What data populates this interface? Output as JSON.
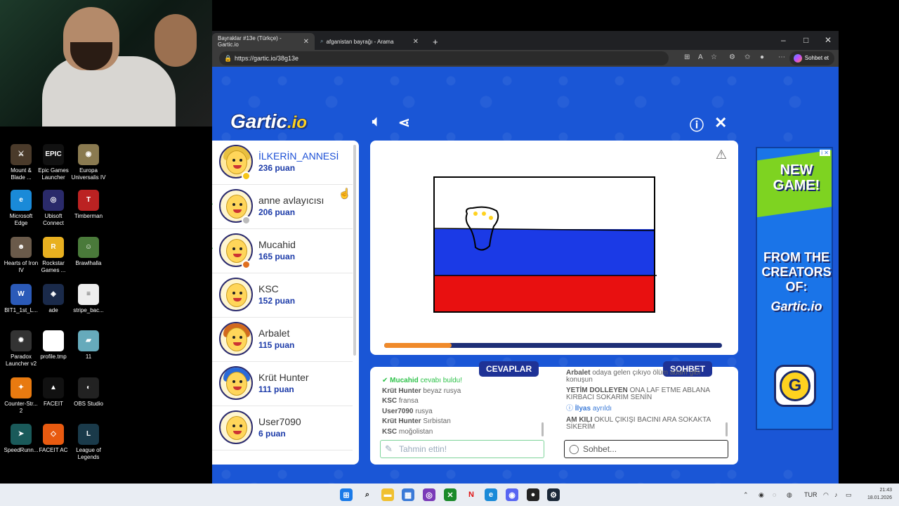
{
  "desktop": {
    "icons": [
      {
        "label": "Mount & Blade ...",
        "color": "#4a3a2a",
        "glyph": "⚔"
      },
      {
        "label": "Epic Games Launcher",
        "color": "#111",
        "glyph": "EPIC"
      },
      {
        "label": "Europa Universalis IV",
        "color": "#8a7a50",
        "glyph": "◉"
      },
      {
        "label": "Microsoft Edge",
        "color": "#1a8ad8",
        "glyph": "e"
      },
      {
        "label": "Ubisoft Connect",
        "color": "#2a2a6a",
        "glyph": "◎"
      },
      {
        "label": "Timberman",
        "color": "#b22",
        "glyph": "T"
      },
      {
        "label": "Hearts of Iron IV",
        "color": "#6a5a4a",
        "glyph": "☻"
      },
      {
        "label": "Rockstar Games ...",
        "color": "#e8b020",
        "glyph": "R"
      },
      {
        "label": "Brawlhalla",
        "color": "#4a7a3a",
        "glyph": "☺"
      },
      {
        "label": "BIT1_1st_L...",
        "color": "#2b5ab8",
        "glyph": "W"
      },
      {
        "label": "ade",
        "color": "#1a2a4a",
        "glyph": "◈"
      },
      {
        "label": "stripe_bac...",
        "color": "#eee",
        "glyph": "≡"
      },
      {
        "label": "Paradox Launcher v2",
        "color": "#333",
        "glyph": "✹"
      },
      {
        "label": "profile.tmp",
        "color": "#fff",
        "glyph": " "
      },
      {
        "label": "11",
        "color": "#6ab",
        "glyph": "▰"
      },
      {
        "label": "Counter-Str... 2",
        "color": "#e87a10",
        "glyph": "✦"
      },
      {
        "label": "FACEIT",
        "color": "#111",
        "glyph": "▲"
      },
      {
        "label": "OBS Studio",
        "color": "#222",
        "glyph": "◐"
      },
      {
        "label": "SpeedRunn...",
        "color": "#1a5a5a",
        "glyph": "➤"
      },
      {
        "label": "FACEIT AC",
        "color": "#e85a10",
        "glyph": "◇"
      },
      {
        "label": "League of Legends",
        "color": "#1a3a4a",
        "glyph": "L"
      }
    ]
  },
  "browser": {
    "tabs": [
      {
        "title": "Bayraklar #13e (Türkçe) - Gartic.io",
        "active": true
      },
      {
        "title": "afganistan bayrağı - Arama",
        "active": false
      }
    ],
    "new_tab": "+",
    "url": "https://gartic.io/38g13e",
    "copilot_label": "Sohbet et",
    "window_controls": [
      "–",
      "□",
      "✕"
    ]
  },
  "game": {
    "logo_main": "Gartic",
    "logo_io": ".io",
    "players": [
      {
        "name": "İLKERİN_ANNESİ",
        "score": "236 puan",
        "drawing": true,
        "guessed": false,
        "dot": "#f5c518",
        "hair": "#e8c040",
        "highlight": true
      },
      {
        "name": "anne avlayıcısı",
        "score": "206 puan",
        "drawing": false,
        "guessed": true,
        "dot": "#bbbbbb",
        "hair": "",
        "highlight": false
      },
      {
        "name": "Mucahid",
        "score": "165 puan",
        "drawing": false,
        "guessed": true,
        "dot": "#e07020",
        "hair": "",
        "highlight": false
      },
      {
        "name": "KSC",
        "score": "152 puan",
        "drawing": false,
        "guessed": false,
        "dot": "",
        "hair": "",
        "highlight": false
      },
      {
        "name": "Arbalet",
        "score": "115 puan",
        "drawing": false,
        "guessed": false,
        "dot": "",
        "hair": "#d2691e",
        "highlight": false
      },
      {
        "name": "Krüt Hunter",
        "score": "111 puan",
        "drawing": false,
        "guessed": false,
        "dot": "",
        "hair": "#2a6ad8",
        "highlight": false
      },
      {
        "name": "User7090",
        "score": "6 puan",
        "drawing": false,
        "guessed": false,
        "dot": "",
        "hair": "",
        "highlight": false
      }
    ],
    "timer_progress": 0.2,
    "answers_tab": "CEVAPLAR",
    "chat_tab": "SOHBET",
    "answers": [
      {
        "user": "Mucahid",
        "text": "cevabı buldu!",
        "kind": "correct"
      },
      {
        "user": "Krüt Hunter",
        "text": "beyaz rusya",
        "kind": "normal"
      },
      {
        "user": "KSC",
        "text": "fransa",
        "kind": "normal"
      },
      {
        "user": "User7090",
        "text": "rusya",
        "kind": "normal"
      },
      {
        "user": "Krüt Hunter",
        "text": "Sırbistan",
        "kind": "normal"
      },
      {
        "user": "KSC",
        "text": "moğolistan",
        "kind": "normal"
      }
    ],
    "chat": [
      {
        "user": "Arbalet",
        "text": "odaya gelen çıkıyo ölüm adam gibi konuşun",
        "kind": "normal"
      },
      {
        "user": "YETİM DOLLEYEN",
        "text": "ONA LAF ETME ABLANA KIRBACI SOKARIM SENİN",
        "kind": "normal"
      },
      {
        "user": "İlyas",
        "text": "ayrıldı",
        "kind": "left"
      },
      {
        "user": "AM KILI",
        "text": "OKUL ÇIKIŞI BACINI ARA SOKAKTA SİKERİM",
        "kind": "normal"
      }
    ],
    "answer_placeholder": "Tahmin ettin!",
    "chat_placeholder": "Sohbet..."
  },
  "ad": {
    "tag": "i ✕",
    "line1": "NEW GAME!",
    "line2": "FROM THE CREATORS OF:",
    "line3": "Gartic.io",
    "button": "G"
  },
  "taskbar": {
    "lang": "TUR",
    "time": "21:43",
    "date": "18.01.2026"
  }
}
